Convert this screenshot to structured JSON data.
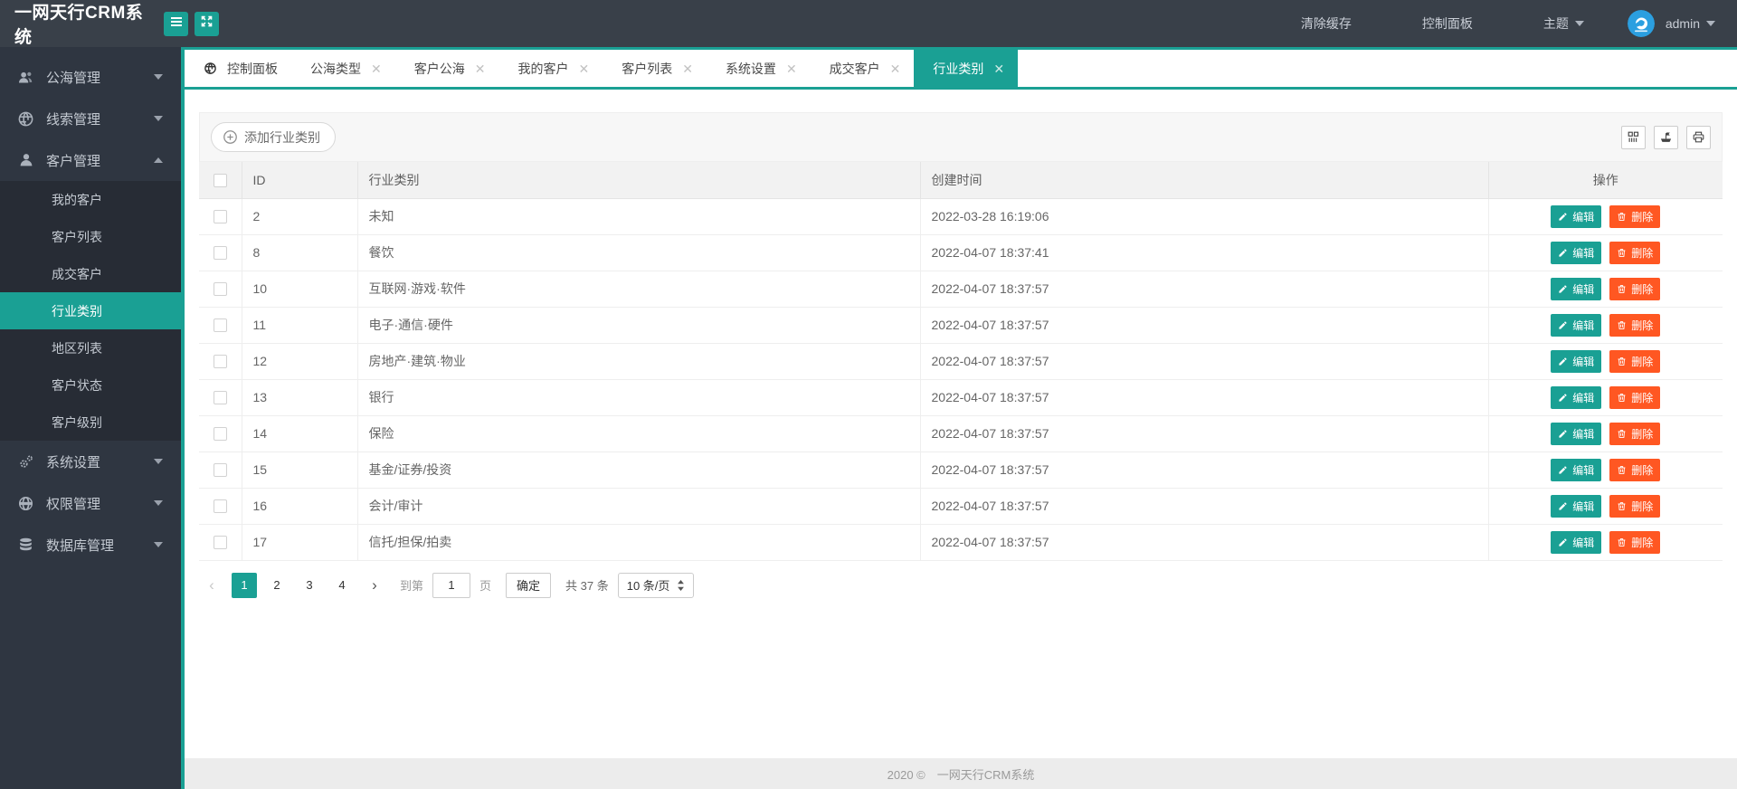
{
  "app": {
    "title": "一网天行CRM系统"
  },
  "header": {
    "clear_cache": "清除缓存",
    "control_panel": "控制面板",
    "theme_label": "主题",
    "username": "admin",
    "accent_color": "#1aa094",
    "bg_color": "#394049"
  },
  "sidebar": {
    "items": [
      {
        "key": "public-sea",
        "label": "公海管理",
        "icon": "users-icon",
        "expanded": false
      },
      {
        "key": "leads",
        "label": "线索管理",
        "icon": "globe-icon",
        "expanded": false
      },
      {
        "key": "customer",
        "label": "客户管理",
        "icon": "user-icon",
        "expanded": true,
        "children": [
          {
            "key": "my-customers",
            "label": "我的客户",
            "active": false
          },
          {
            "key": "customer-list",
            "label": "客户列表",
            "active": false
          },
          {
            "key": "deal-customers",
            "label": "成交客户",
            "active": false
          },
          {
            "key": "industry-category",
            "label": "行业类别",
            "active": true
          },
          {
            "key": "region-list",
            "label": "地区列表",
            "active": false
          },
          {
            "key": "customer-status",
            "label": "客户状态",
            "active": false
          },
          {
            "key": "customer-level",
            "label": "客户级别",
            "active": false
          }
        ]
      },
      {
        "key": "system",
        "label": "系统设置",
        "icon": "gears-icon",
        "expanded": false
      },
      {
        "key": "permission",
        "label": "权限管理",
        "icon": "globe-grid-icon",
        "expanded": false
      },
      {
        "key": "database",
        "label": "数据库管理",
        "icon": "database-icon",
        "expanded": false
      }
    ]
  },
  "tabs": [
    {
      "label": "控制面板",
      "closable": false,
      "active": false,
      "has_icon": true
    },
    {
      "label": "公海类型",
      "closable": true,
      "active": false
    },
    {
      "label": "客户公海",
      "closable": true,
      "active": false
    },
    {
      "label": "我的客户",
      "closable": true,
      "active": false
    },
    {
      "label": "客户列表",
      "closable": true,
      "active": false
    },
    {
      "label": "系统设置",
      "closable": true,
      "active": false
    },
    {
      "label": "成交客户",
      "closable": true,
      "active": false
    },
    {
      "label": "行业类别",
      "closable": true,
      "active": true
    }
  ],
  "toolbar": {
    "add_label": "添加行业类别",
    "icon_buttons": [
      "columns-filter-icon",
      "export-icon",
      "print-icon"
    ]
  },
  "table": {
    "columns": [
      "ID",
      "行业类别",
      "创建时间",
      "操作"
    ],
    "edit_label": "编辑",
    "delete_label": "删除",
    "rows": [
      {
        "id": "2",
        "name": "未知",
        "created": "2022-03-28 16:19:06"
      },
      {
        "id": "8",
        "name": "餐饮",
        "created": "2022-04-07 18:37:41"
      },
      {
        "id": "10",
        "name": "互联网·游戏·软件",
        "created": "2022-04-07 18:37:57"
      },
      {
        "id": "11",
        "name": "电子·通信·硬件",
        "created": "2022-04-07 18:37:57"
      },
      {
        "id": "12",
        "name": "房地产·建筑·物业",
        "created": "2022-04-07 18:37:57"
      },
      {
        "id": "13",
        "name": "银行",
        "created": "2022-04-07 18:37:57"
      },
      {
        "id": "14",
        "name": "保险",
        "created": "2022-04-07 18:37:57"
      },
      {
        "id": "15",
        "name": "基金/证券/投资",
        "created": "2022-04-07 18:37:57"
      },
      {
        "id": "16",
        "name": "会计/审计",
        "created": "2022-04-07 18:37:57"
      },
      {
        "id": "17",
        "name": "信托/担保/拍卖",
        "created": "2022-04-07 18:37:57"
      }
    ]
  },
  "pagination": {
    "pages": [
      "1",
      "2",
      "3",
      "4"
    ],
    "active_page": "1",
    "goto_label": "到第",
    "goto_value": "1",
    "page_unit_label": "页",
    "confirm_label": "确定",
    "total_label": "共 37 条",
    "page_size_label": "10 条/页"
  },
  "footer": {
    "text": "2020 ©　一网天行CRM系统"
  }
}
